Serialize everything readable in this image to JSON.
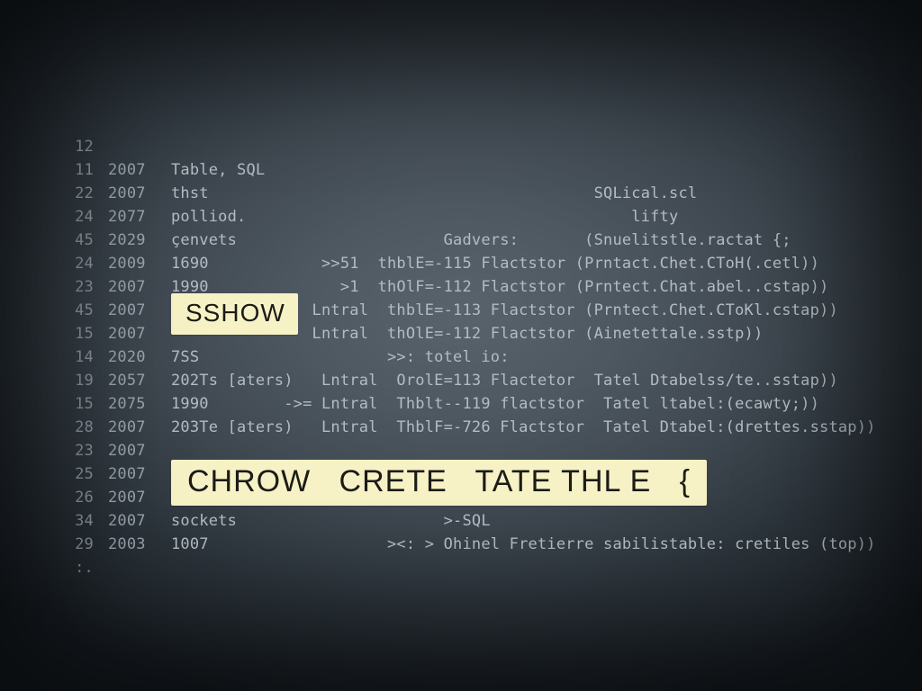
{
  "highlights": {
    "small": "SSHOW",
    "large": "CHROW   CRETE   TATE THL E   {"
  },
  "lines": [
    {
      "n": "12",
      "y": "",
      "t": ""
    },
    {
      "n": "11",
      "y": "2007",
      "t": "Table, SQL"
    },
    {
      "n": "22",
      "y": "2007",
      "t": "thst                                         SQLical.scl"
    },
    {
      "n": "24",
      "y": "2077",
      "t": "polliod.                                         lifty"
    },
    {
      "n": "45",
      "y": "2029",
      "t": "çenvets                      Gadvers:       (Snuelitstle.ractat {;"
    },
    {
      "n": "24",
      "y": "2009",
      "t": "1690            >>51  thblE=-115 Flactstor (Prntact.Chet.CToH(.cetl))"
    },
    {
      "n": "23",
      "y": "2007",
      "t": "1990              >1  thOlF=-112 Flactstor (Prntect.Chat.abel..cstap))"
    },
    {
      "n": "45",
      "y": "2007",
      "t": "               Lntral  thblE=-113 Flactstor (Prntect.Chet.CToKl.cstap))"
    },
    {
      "n": "15",
      "y": "2007",
      "t": "               Lntral  thOlE=-112 Flactstor (Ainetettale.sstp))"
    },
    {
      "n": "14",
      "y": "2020",
      "t": "7SS                    >>: totel io:"
    },
    {
      "n": "19",
      "y": "2057",
      "t": "202Ts [aters)   Lntral  OrolE=113 Flactetor  Tatel Dtabelss/te..sstap))"
    },
    {
      "n": "15",
      "y": "2075",
      "t": "1990        ->= Lntral  Thblt--119 flactstor  Tatel ltabel:(ecawty;))"
    },
    {
      "n": "28",
      "y": "2007",
      "t": "203Te [aters)   Lntral  ThblF=-726 Flactstor  Tatel Dtabel:(drettes.sstap))"
    },
    {
      "n": "23",
      "y": "2007",
      "t": ""
    },
    {
      "n": "25",
      "y": "2007",
      "t": ""
    },
    {
      "n": "26",
      "y": "2007",
      "t": ""
    },
    {
      "n": "34",
      "y": "2007",
      "t": "sockets                      >-SQL"
    },
    {
      "n": "29",
      "y": "2003",
      "t": "1007                   ><: > Ohinel Fretierre sabilistable: cretiles (top))"
    },
    {
      "n": ":.",
      "y": "",
      "t": ""
    }
  ]
}
